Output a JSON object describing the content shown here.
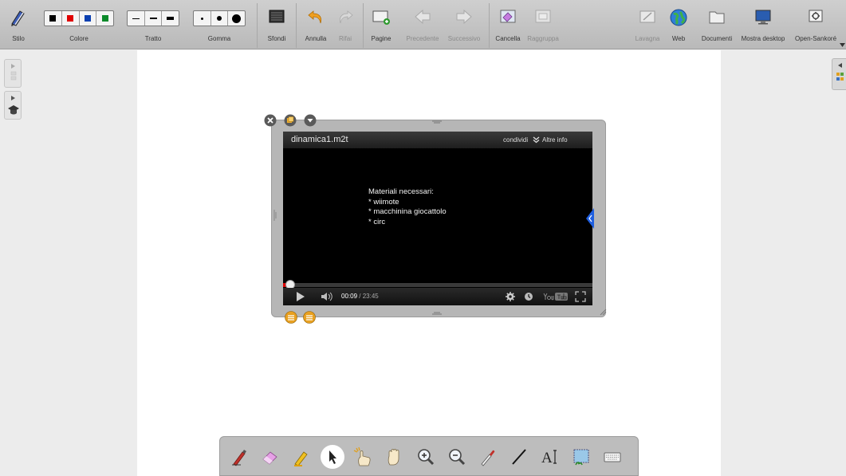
{
  "toolbar": {
    "stilo": "Stilo",
    "colore": "Colore",
    "tratto": "Tratto",
    "gomma": "Gomma",
    "sfondi": "Sfondi",
    "annulla": "Annulla",
    "rifai": "Rifai",
    "pagine": "Pagine",
    "precedente": "Precedente",
    "successivo": "Successivo",
    "cancella": "Cancella",
    "raggruppa": "Raggruppa",
    "lavagna": "Lavagna",
    "web": "Web",
    "documenti": "Documenti",
    "mostra_desktop": "Mostra desktop",
    "open_sankore": "Open-Sankoré"
  },
  "colors": {
    "palette": [
      "#000000",
      "#e00000",
      "#0a3fb0",
      "#0a8a2a"
    ],
    "toolbar_bg": "#c4c4c4",
    "board_bg": "#ffffff",
    "progress": "#dd0000",
    "accent_blue": "#1f5fe0"
  },
  "video": {
    "title": "dinamica1.m2t",
    "share": "condividi",
    "more_info": "Altre info",
    "slide_lines": [
      "Materiali necessari:",
      "* wiimote",
      "* macchinina giocattolo",
      "* circ"
    ],
    "current_time": "00:09",
    "duration": "/ 23:45",
    "progress_fraction": 0.006
  },
  "palette_icons": [
    "pen-icon",
    "eraser-icon",
    "highlighter-icon",
    "pointer-icon",
    "laser-pointer-icon",
    "hand-icon",
    "zoom-in-icon",
    "zoom-out-icon",
    "eyedropper-icon",
    "line-icon",
    "text-icon",
    "capture-icon",
    "keyboard-icon"
  ]
}
